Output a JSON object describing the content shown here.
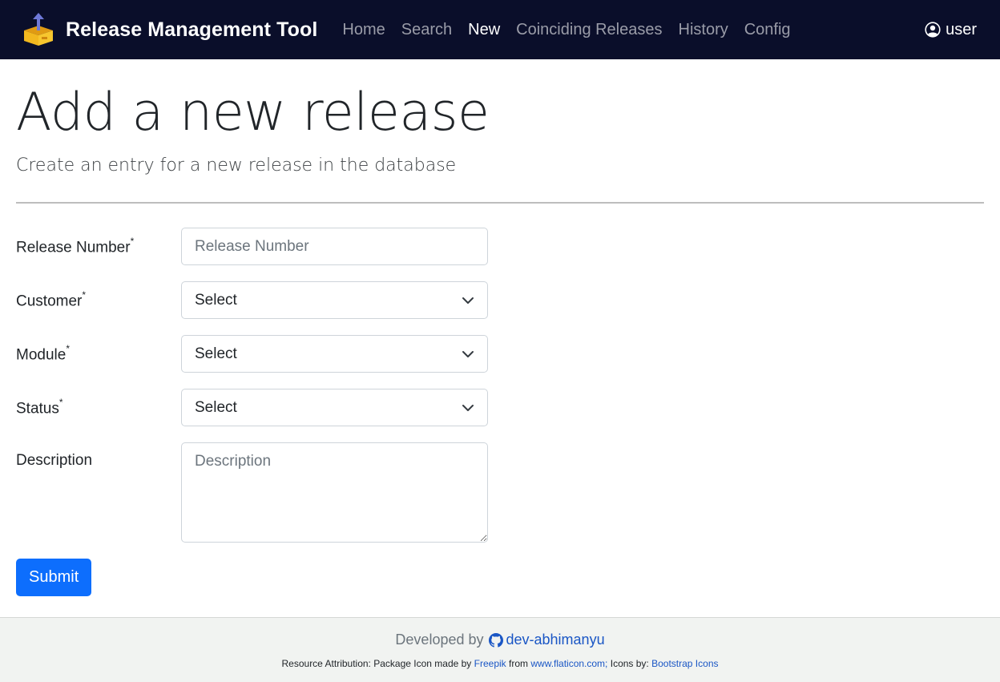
{
  "navbar": {
    "title": "Release Management Tool",
    "links": [
      {
        "label": "Home"
      },
      {
        "label": "Search"
      },
      {
        "label": "New"
      },
      {
        "label": "Coinciding Releases"
      },
      {
        "label": "History"
      },
      {
        "label": "Config"
      }
    ],
    "active": "New",
    "user_label": "user"
  },
  "page": {
    "title": "Add a new release",
    "subtitle": "Create an entry for a new release in the database"
  },
  "form": {
    "release_number": {
      "label": "Release Number",
      "required_mark": "*",
      "placeholder": "Release Number",
      "value": ""
    },
    "customer": {
      "label": "Customer",
      "required_mark": "*",
      "selected": "Select"
    },
    "module": {
      "label": "Module",
      "required_mark": "*",
      "selected": "Select"
    },
    "status": {
      "label": "Status",
      "required_mark": "*",
      "selected": "Select"
    },
    "description": {
      "label": "Description",
      "placeholder": "Description",
      "value": ""
    },
    "submit_label": "Submit"
  },
  "footer": {
    "developed_by": "Developed by",
    "developer": "dev-abhimanyu",
    "attr_prefix": "Resource Attribution: Package Icon made by",
    "attr_author": "Freepik",
    "attr_from": "from",
    "attr_site": "www.flaticon.com;",
    "attr_icons": "Icons by:",
    "attr_icons_link": "Bootstrap Icons"
  },
  "colors": {
    "navbar_bg": "#0a0e2a",
    "primary": "#0d6efd",
    "link": "#1a56c5",
    "footer_bg": "#f1f3f1"
  },
  "icons": {
    "brand": "package-upload-icon",
    "user": "person-circle-icon",
    "select_caret": "chevron-down-icon",
    "github": "github-icon"
  }
}
